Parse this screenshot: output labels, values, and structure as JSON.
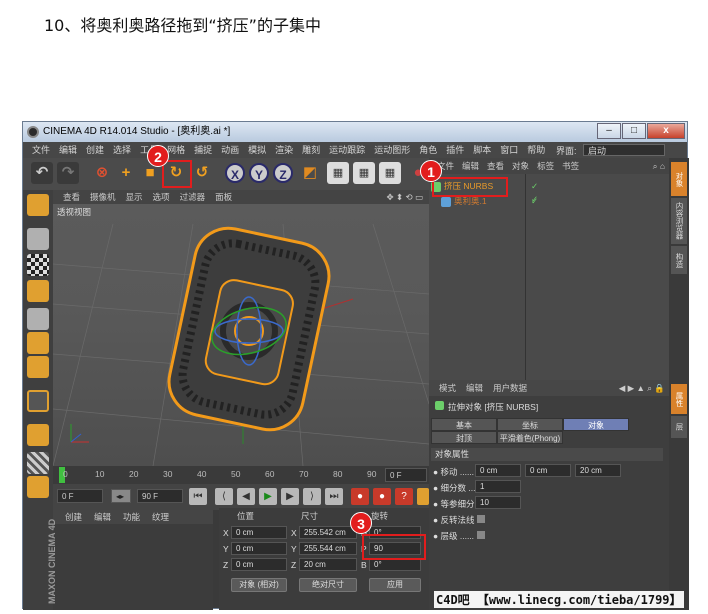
{
  "heading": "10、将奥利奥路径拖到“挤压”的子集中",
  "window": {
    "title": "CINEMA 4D R14.014 Studio - [奥利奥.ai *]",
    "buttons": {
      "minimize": "–",
      "maximize": "□",
      "close": "x"
    }
  },
  "menubar": {
    "items": [
      "文件",
      "编辑",
      "创建",
      "选择",
      "工具",
      "网格",
      "捕捉",
      "动画",
      "模拟",
      "渲染",
      "雕刻",
      "运动跟踪",
      "运动图形",
      "角色",
      "插件",
      "脚本",
      "窗口",
      "帮助"
    ],
    "interface_label": "界面:",
    "interface_value": "启动"
  },
  "toolbar": {
    "axis_labels": [
      "X",
      "Y",
      "Z"
    ]
  },
  "viewport": {
    "menu": [
      "查看",
      "摄像机",
      "显示",
      "选项",
      "过滤器",
      "面板"
    ],
    "label": "透视视图"
  },
  "timeline": {
    "ticks": [
      "0",
      "10",
      "20",
      "30",
      "40",
      "50",
      "60",
      "70",
      "80",
      "90"
    ],
    "frame": "0 F"
  },
  "transport": {
    "start": "0 F",
    "end": "90 F"
  },
  "material": {
    "menu": [
      "创建",
      "编辑",
      "功能",
      "纹理"
    ],
    "brand": "MAXON CINEMA 4D"
  },
  "coordinates": {
    "headers": [
      "位置",
      "尺寸",
      "旋转"
    ],
    "rows": [
      {
        "axis": "X",
        "pos": "0 cm",
        "size_axis": "X",
        "size": "255.542 cm",
        "rot_axis": "H",
        "rot": "0°"
      },
      {
        "axis": "Y",
        "pos": "0 cm",
        "size_axis": "Y",
        "size": "255.544 cm",
        "rot_axis": "P",
        "rot": "90"
      },
      {
        "axis": "Z",
        "pos": "0 cm",
        "size_axis": "Z",
        "size": "20 cm",
        "rot_axis": "B",
        "rot": "0°"
      }
    ],
    "mode": "对象 (相对)",
    "size_mode": "绝对尺寸",
    "apply": "应用"
  },
  "objects": {
    "menu": [
      "文件",
      "编辑",
      "查看",
      "对象",
      "标签",
      "书签"
    ],
    "items": [
      {
        "name": "挤压 NURBS"
      },
      {
        "name": "奥利奥.1"
      }
    ]
  },
  "attributes": {
    "menu": [
      "模式",
      "编辑",
      "用户数据"
    ],
    "object": "拉伸对象 [挤压 NURBS]",
    "tabs": [
      "基本",
      "坐标",
      "对象",
      "封顶",
      "平滑着色(Phong)"
    ],
    "active_tab": "对象",
    "section": "对象属性",
    "props": {
      "move_label": "● 移动 ......",
      "move_x": "0 cm",
      "move_y": "0 cm",
      "move_z": "20 cm",
      "subdiv_label": "● 细分数 ....",
      "subdiv": "1",
      "iso_label": "● 等参细分",
      "iso": "10",
      "flip_label": "● 反转法线",
      "hier_label": "● 层级 ......"
    }
  },
  "right_tabs": [
    "对象",
    "内容浏览器",
    "构造",
    "属性",
    "层"
  ],
  "markers": [
    "1",
    "2",
    "3"
  ],
  "watermark": "C4D吧 【www.linecg.com/tieba/1799】"
}
